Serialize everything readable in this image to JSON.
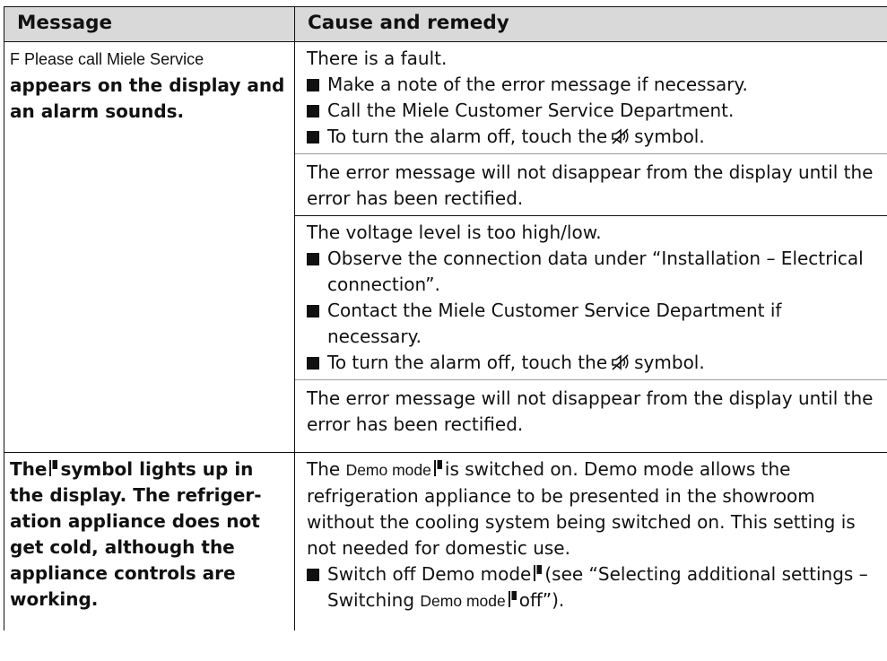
{
  "header": {
    "col1": "Message",
    "col2": "Cause and remedy"
  },
  "row1": {
    "message_code": "F Please call Miele Service",
    "message_text": "appears on the display and an alarm sounds.",
    "cause1": {
      "intro": "There is a fault.",
      "bullet1": "Make a note of the error message if necessary.",
      "bullet2": "Call the Miele Customer Service Department.",
      "bullet3_pre": "To turn the alarm off, touch the",
      "bullet3_post": "symbol.",
      "note": "The error message will not disappear from the display until the error has been rectified."
    },
    "cause2": {
      "intro": "The voltage level is too high/low.",
      "bullet1": "Observe the connection data under “Installation – Electrical connection”.",
      "bullet2": "Contact the Miele Customer Service Department if necessary.",
      "bullet3_pre": "To turn the alarm off, touch the",
      "bullet3_post": "symbol.",
      "note": "The error message will not disappear from the display until the error has been rectified."
    }
  },
  "row2": {
    "msg_pre": "The",
    "msg_post": "symbol lights up in the display. The refriger­ation appliance does not get cold, although the appliance controls are working.",
    "cause_pre": "The",
    "demo_label": "Demo mode",
    "cause_post": "is switched on. Demo mode allows the refrigeration appliance to be presented in the showroom without the cooling system being switched on. This setting is not needed for domestic use.",
    "bullet_pre": "Switch off Demo mode",
    "bullet_mid": "(see “Selecting additional settings – Switching",
    "bullet_demo": "Demo mode",
    "bullet_post": "off”)."
  },
  "icons": {
    "mute": "alarm-mute-icon",
    "demo": "demo-mode-icon"
  }
}
